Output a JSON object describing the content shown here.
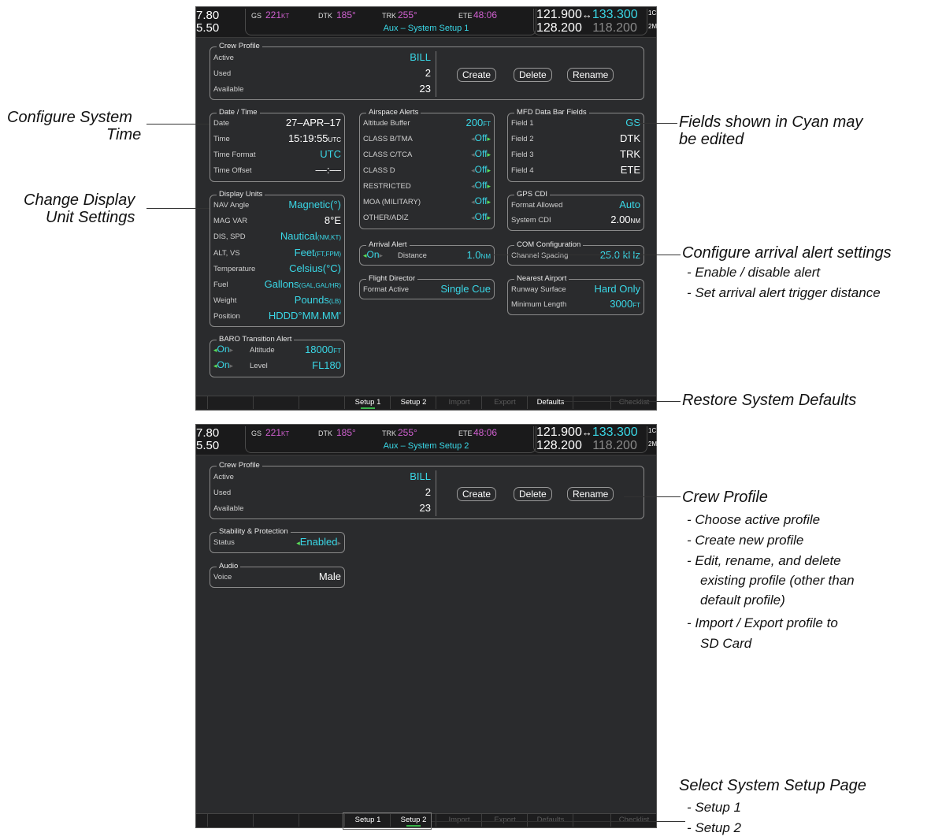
{
  "status_bar": {
    "left_top": "7.80",
    "left_bottom": "5.50",
    "gs_label": "GS",
    "gs_value": "221",
    "gs_unit": "KT",
    "dtk_label": "DTK",
    "dtk_value": "185°",
    "trk_label": "TRK",
    "trk_value": "255°",
    "ete_label": "ETE",
    "ete_value": "48:06",
    "com1_active": "121.900",
    "com1_swap": "↔",
    "com1_standby": "133.300",
    "com2_active": "128.200",
    "com2_standby": "118.200",
    "com_tag_top": "1C",
    "com_tag_bottom": "2M"
  },
  "crew_profile": {
    "title": "Crew Profile",
    "active_label": "Active",
    "active_value": "BILL",
    "used_label": "Used",
    "used_value": "2",
    "available_label": "Available",
    "available_value": "23",
    "create_label": "Create",
    "delete_label": "Delete",
    "rename_label": "Rename"
  },
  "setup1": {
    "page_title": "Aux – System Setup 1",
    "date_time": {
      "title": "Date / Time",
      "rows": [
        {
          "label": "Date",
          "value": "27–APR–17",
          "unit": ""
        },
        {
          "label": "Time",
          "value": "15:19:55",
          "unit": "UTC"
        },
        {
          "label": "Time Format",
          "value": "UTC",
          "unit": ""
        },
        {
          "label": "Time Offset",
          "value": "––:––",
          "unit": ""
        }
      ]
    },
    "display_units": {
      "title": "Display Units",
      "rows": [
        {
          "label": "NAV Angle",
          "value": "Magnetic(°)",
          "unit": ""
        },
        {
          "label": "MAG VAR",
          "value": "8°E",
          "unit": ""
        },
        {
          "label": "DIS, SPD",
          "value": "Nautical",
          "unit": "(NM,KT)"
        },
        {
          "label": "ALT, VS",
          "value": "Feet",
          "unit": "(FT,FPM)"
        },
        {
          "label": "Temperature",
          "value": "Celsius(°C)",
          "unit": ""
        },
        {
          "label": "Fuel",
          "value": "Gallons",
          "unit": "(GAL,GAL/HR)"
        },
        {
          "label": "Weight",
          "value": "Pounds",
          "unit": "(LB)"
        },
        {
          "label": "Position",
          "value": "HDDD°MM.MM'",
          "unit": ""
        }
      ]
    },
    "baro": {
      "title": "BARO Transition Alert",
      "rows": [
        {
          "state": "On",
          "label": "Altitude",
          "value": "18000",
          "unit": "FT"
        },
        {
          "state": "On",
          "label": "Level",
          "value": "FL180",
          "unit": ""
        }
      ]
    },
    "airspace": {
      "title": "Airspace Alerts",
      "buffer_label": "Altitude Buffer",
      "buffer_value": "200",
      "buffer_unit": "FT",
      "rows": [
        {
          "label": "CLASS B/TMA",
          "value": "Off"
        },
        {
          "label": "CLASS C/TCA",
          "value": "Off"
        },
        {
          "label": "CLASS D",
          "value": "Off"
        },
        {
          "label": "RESTRICTED",
          "value": "Off"
        },
        {
          "label": "MOA (MILITARY)",
          "value": "Off"
        },
        {
          "label": "OTHER/ADIZ",
          "value": "Off"
        }
      ]
    },
    "arrival": {
      "title": "Arrival Alert",
      "state": "On",
      "distance_label": "Distance",
      "distance_value": "1.0",
      "distance_unit": "NM"
    },
    "flight_director": {
      "title": "Flight Director",
      "label": "Format Active",
      "value": "Single Cue"
    },
    "mfd_fields": {
      "title": "MFD Data Bar Fields",
      "rows": [
        {
          "label": "Field 1",
          "value": "GS"
        },
        {
          "label": "Field 2",
          "value": "DTK"
        },
        {
          "label": "Field 3",
          "value": "TRK"
        },
        {
          "label": "Field 4",
          "value": "ETE"
        }
      ]
    },
    "gps_cdi": {
      "title": "GPS CDI",
      "format_label": "Format Allowed",
      "format_value": "Auto",
      "system_label": "System CDI",
      "system_value": "2.00",
      "system_unit": "NM"
    },
    "com_config": {
      "title": "COM Configuration",
      "label": "Channel Spacing",
      "value": "25.0 kHz"
    },
    "nearest": {
      "title": "Nearest Airport",
      "surface_label": "Runway Surface",
      "surface_value": "Hard Only",
      "length_label": "Minimum Length",
      "length_value": "3000",
      "length_unit": "FT"
    }
  },
  "setup2": {
    "page_title": "Aux – System Setup 2",
    "stability": {
      "title": "Stability & Protection",
      "label": "Status",
      "value": "Enabled"
    },
    "audio": {
      "title": "Audio",
      "label": "Voice",
      "value": "Male"
    }
  },
  "softkeys": {
    "setup1": "Setup 1",
    "setup2": "Setup 2",
    "import": "Import",
    "export": "Export",
    "defaults": "Defaults",
    "checklist": "Checklist"
  },
  "annotations": {
    "configure_time_l1": "Configure System",
    "configure_time_l2": "Time",
    "display_units_l1": "Change Display",
    "display_units_l2": "Unit Settings",
    "fields_cyan_l1": "Fields shown in Cyan may",
    "fields_cyan_l2": "be edited",
    "arrival_title": "Configure arrival alert settings",
    "arrival_b1": "- Enable / disable alert",
    "arrival_b2": "- Set arrival alert trigger distance",
    "restore_defaults": "Restore System Defaults",
    "crew_title": "Crew Profile",
    "crew_b1": "- Choose active profile",
    "crew_b2": "- Create new profile",
    "crew_b3": "- Edit, rename, and delete",
    "crew_b3b": "existing profile (other than",
    "crew_b3c": "default profile)",
    "crew_b4": "- Import / Export profile to",
    "crew_b4b": "SD Card",
    "select_title": "Select System Setup Page",
    "select_b1": "- Setup 1",
    "select_b2": "- Setup 2"
  },
  "colors": {
    "cyan": "#3ad7e6",
    "magenta": "#d060d0",
    "green": "#5ae05a",
    "screen_bg": "#2a2b2d"
  }
}
